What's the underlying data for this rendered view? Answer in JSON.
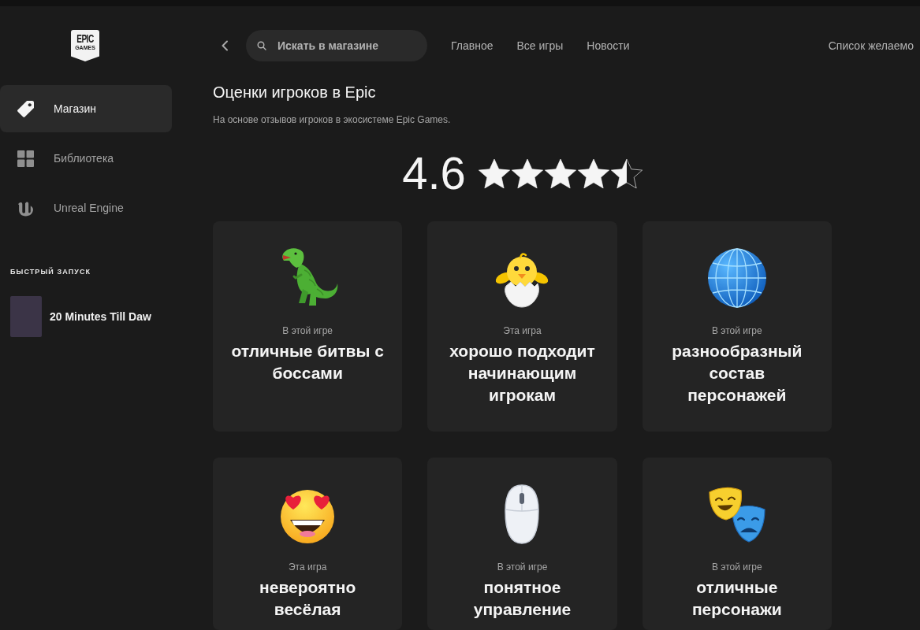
{
  "sidebar": {
    "logo": {
      "line_1": "EPIC",
      "line_2": "GAMES"
    },
    "items": [
      {
        "label": "Магазин",
        "selected": true
      },
      {
        "label": "Библиотека",
        "selected": false
      },
      {
        "label": "Unreal Engine",
        "selected": false
      }
    ],
    "quick_launch": {
      "heading": "БЫСТРЫЙ ЗАПУСК",
      "items": [
        {
          "title": "20 Minutes Till Daw"
        }
      ]
    }
  },
  "top_bar": {
    "search": {
      "placeholder": "Искать в магазине"
    },
    "nav": [
      {
        "label": "Главное"
      },
      {
        "label": "Все игры"
      },
      {
        "label": "Новости"
      }
    ],
    "wishlist": "Список желаемо"
  },
  "ratings": {
    "title": "Оценки игроков в Epic",
    "subtitle": "На основе отзывов игроков в экосистеме Epic Games.",
    "score": "4.6",
    "stars": 4.5,
    "cards": [
      {
        "label": "В этой игре",
        "text": "отличные битвы с боссами"
      },
      {
        "label": "Эта игра",
        "text": "хорошо подходит начинающим игрокам"
      },
      {
        "label": "В этой игре",
        "text": "разнообразный состав персонажей"
      },
      {
        "label": "Эта игра",
        "text": "невероятно весёлая"
      },
      {
        "label": "В этой игре",
        "text": "понятное управление"
      },
      {
        "label": "В этой игре",
        "text": "отличные персонажи"
      }
    ]
  }
}
